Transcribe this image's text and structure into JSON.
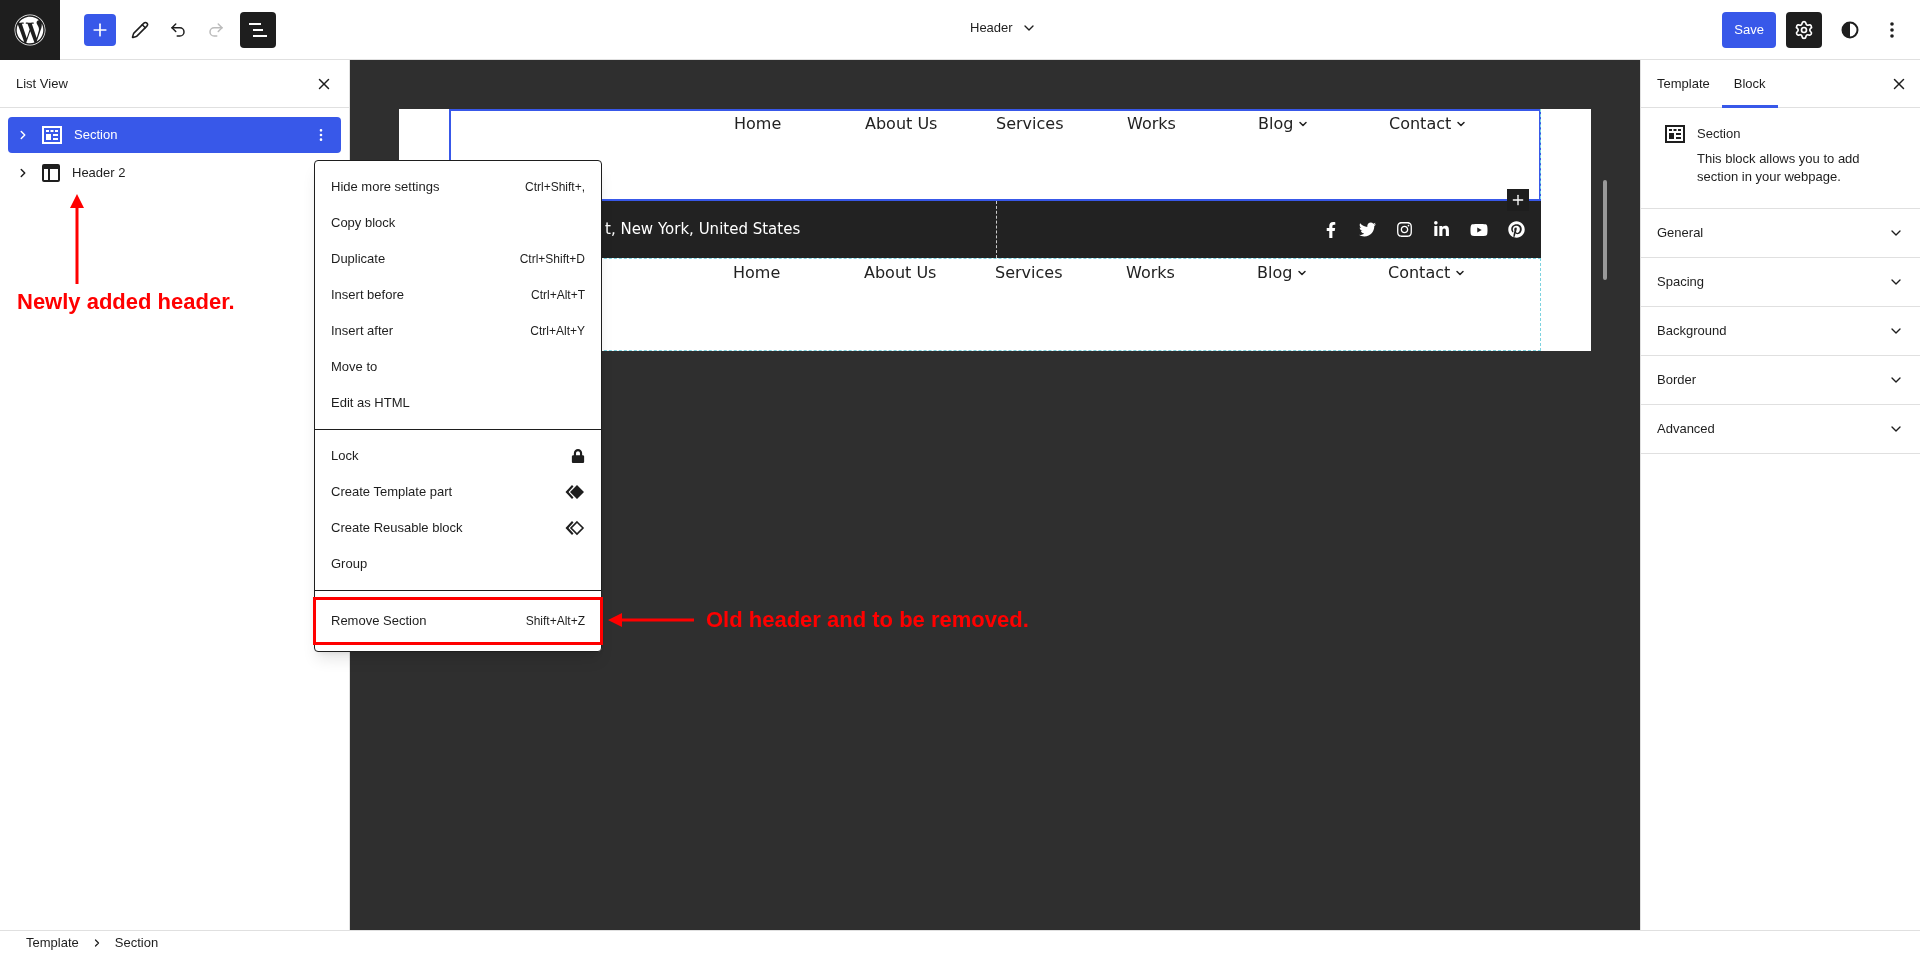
{
  "toolbar": {
    "document_title": "Header",
    "save": "Save"
  },
  "list_view": {
    "title": "List View",
    "items": [
      {
        "label": "Section",
        "selected": true,
        "kind": "section"
      },
      {
        "label": "Header 2",
        "selected": false,
        "kind": "template-part"
      }
    ]
  },
  "context_menu": {
    "groups": [
      [
        {
          "label": "Hide more settings",
          "shortcut": "Ctrl+Shift+,",
          "kind": "shortcut",
          "annotated": false
        },
        {
          "label": "Copy block",
          "kind": "plain",
          "annotated": false
        },
        {
          "label": "Duplicate",
          "shortcut": "Ctrl+Shift+D",
          "kind": "shortcut",
          "annotated": false
        },
        {
          "label": "Insert before",
          "shortcut": "Ctrl+Alt+T",
          "kind": "shortcut",
          "annotated": false
        },
        {
          "label": "Insert after",
          "shortcut": "Ctrl+Alt+Y",
          "kind": "shortcut",
          "annotated": false
        },
        {
          "label": "Move to",
          "kind": "plain",
          "annotated": false
        },
        {
          "label": "Edit as HTML",
          "kind": "plain",
          "annotated": false
        }
      ],
      [
        {
          "label": "Lock",
          "kind": "lock",
          "annotated": false
        },
        {
          "label": "Create Template part",
          "kind": "template-part",
          "annotated": false
        },
        {
          "label": "Create Reusable block",
          "kind": "reusable",
          "annotated": false
        },
        {
          "label": "Group",
          "kind": "plain",
          "annotated": false
        }
      ],
      [
        {
          "label": "Remove Section",
          "shortcut": "Shift+Alt+Z",
          "kind": "shortcut",
          "annotated": true
        }
      ]
    ]
  },
  "canvas": {
    "nav_top": [
      {
        "label": "Home",
        "has_submenu": false
      },
      {
        "label": "About Us",
        "has_submenu": false
      },
      {
        "label": "Services",
        "has_submenu": false
      },
      {
        "label": "Works",
        "has_submenu": false
      },
      {
        "label": "Blog",
        "has_submenu": true
      },
      {
        "label": "Contact",
        "has_submenu": true
      }
    ],
    "top_bar_text": "t, New York, United States",
    "nav_bottom": [
      {
        "label": "Home",
        "has_submenu": false
      },
      {
        "label": "About Us",
        "has_submenu": false
      },
      {
        "label": "Services",
        "has_submenu": false
      },
      {
        "label": "Works",
        "has_submenu": false
      },
      {
        "label": "Blog",
        "has_submenu": true
      },
      {
        "label": "Contact",
        "has_submenu": true
      }
    ]
  },
  "inspector": {
    "tabs": [
      {
        "label": "Template",
        "selected": false
      },
      {
        "label": "Block",
        "selected": true
      }
    ],
    "block": {
      "title": "Section",
      "description": "This block allows you to add section in your webpage."
    },
    "panels": [
      {
        "label": "General",
        "expanded": false
      },
      {
        "label": "Spacing",
        "expanded": false
      },
      {
        "label": "Background",
        "expanded": false
      },
      {
        "label": "Border",
        "expanded": false
      },
      {
        "label": "Advanced",
        "expanded": false
      }
    ]
  },
  "breadcrumb": [
    "Template",
    "Section"
  ],
  "annotations": [
    {
      "text": "Newly added header."
    },
    {
      "text": "Old header and to be removed."
    }
  ]
}
